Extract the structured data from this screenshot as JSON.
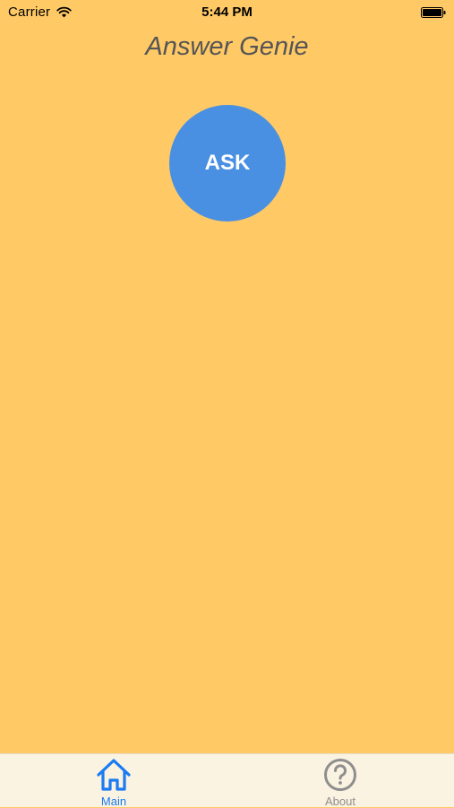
{
  "status_bar": {
    "carrier": "Carrier",
    "time": "5:44 PM",
    "icons": [
      "wifi-icon",
      "battery-icon"
    ]
  },
  "app": {
    "title": "Answer Genie"
  },
  "main": {
    "ask_label": "ASK"
  },
  "tab_bar": {
    "tabs": [
      {
        "label": "Main",
        "icon": "home-icon",
        "selected": true
      },
      {
        "label": "About",
        "icon": "question-circle-icon",
        "selected": false
      }
    ]
  },
  "colors": {
    "background": "#FFC966",
    "ask_button": "#4A90E2",
    "tab_bar_background": "#FBF3E1",
    "tab_selected": "#1A7BF2",
    "tab_unselected": "#8E8E8E",
    "title_text": "#555555"
  }
}
